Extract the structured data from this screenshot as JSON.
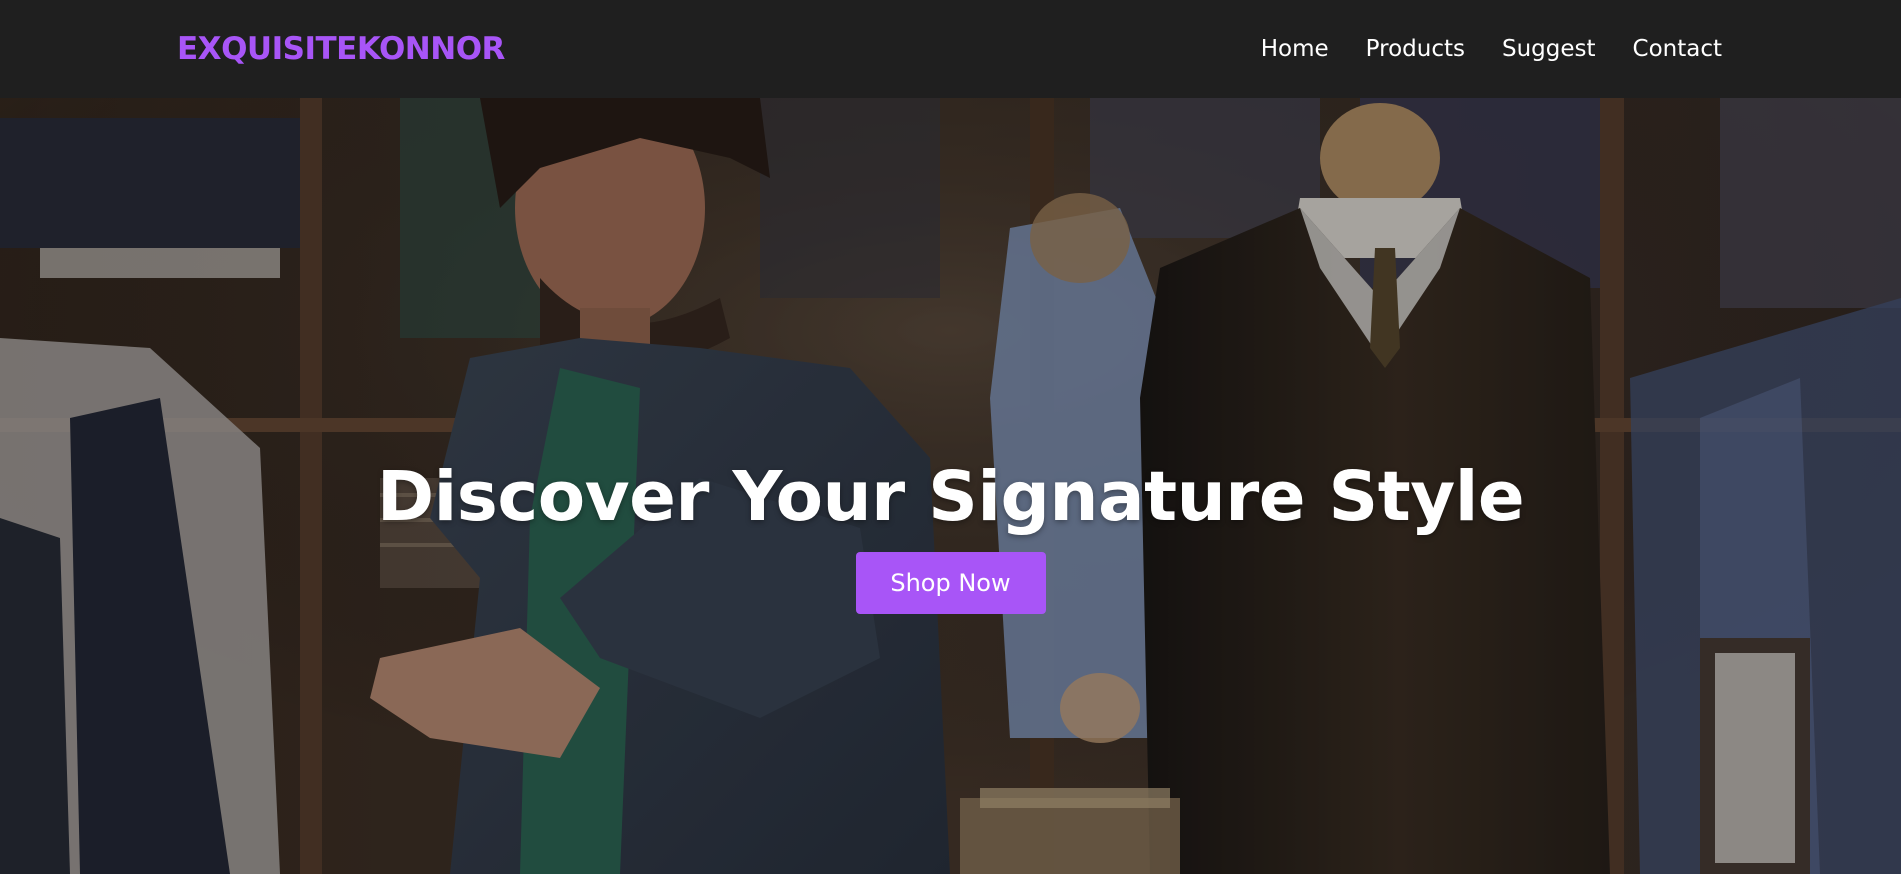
{
  "brand": {
    "name": "EXQUISITEKONNOR"
  },
  "nav": {
    "links": [
      {
        "label": "Home"
      },
      {
        "label": "Products"
      },
      {
        "label": "Suggest"
      },
      {
        "label": "Contact"
      }
    ]
  },
  "hero": {
    "title": "Discover Your Signature Style",
    "cta_label": "Shop Now",
    "image_subject": "man browsing shirts in clothing store with mannequins"
  },
  "colors": {
    "accent": "#a855f7",
    "navbar_bg": "#1f1f1f",
    "text": "#ffffff"
  }
}
